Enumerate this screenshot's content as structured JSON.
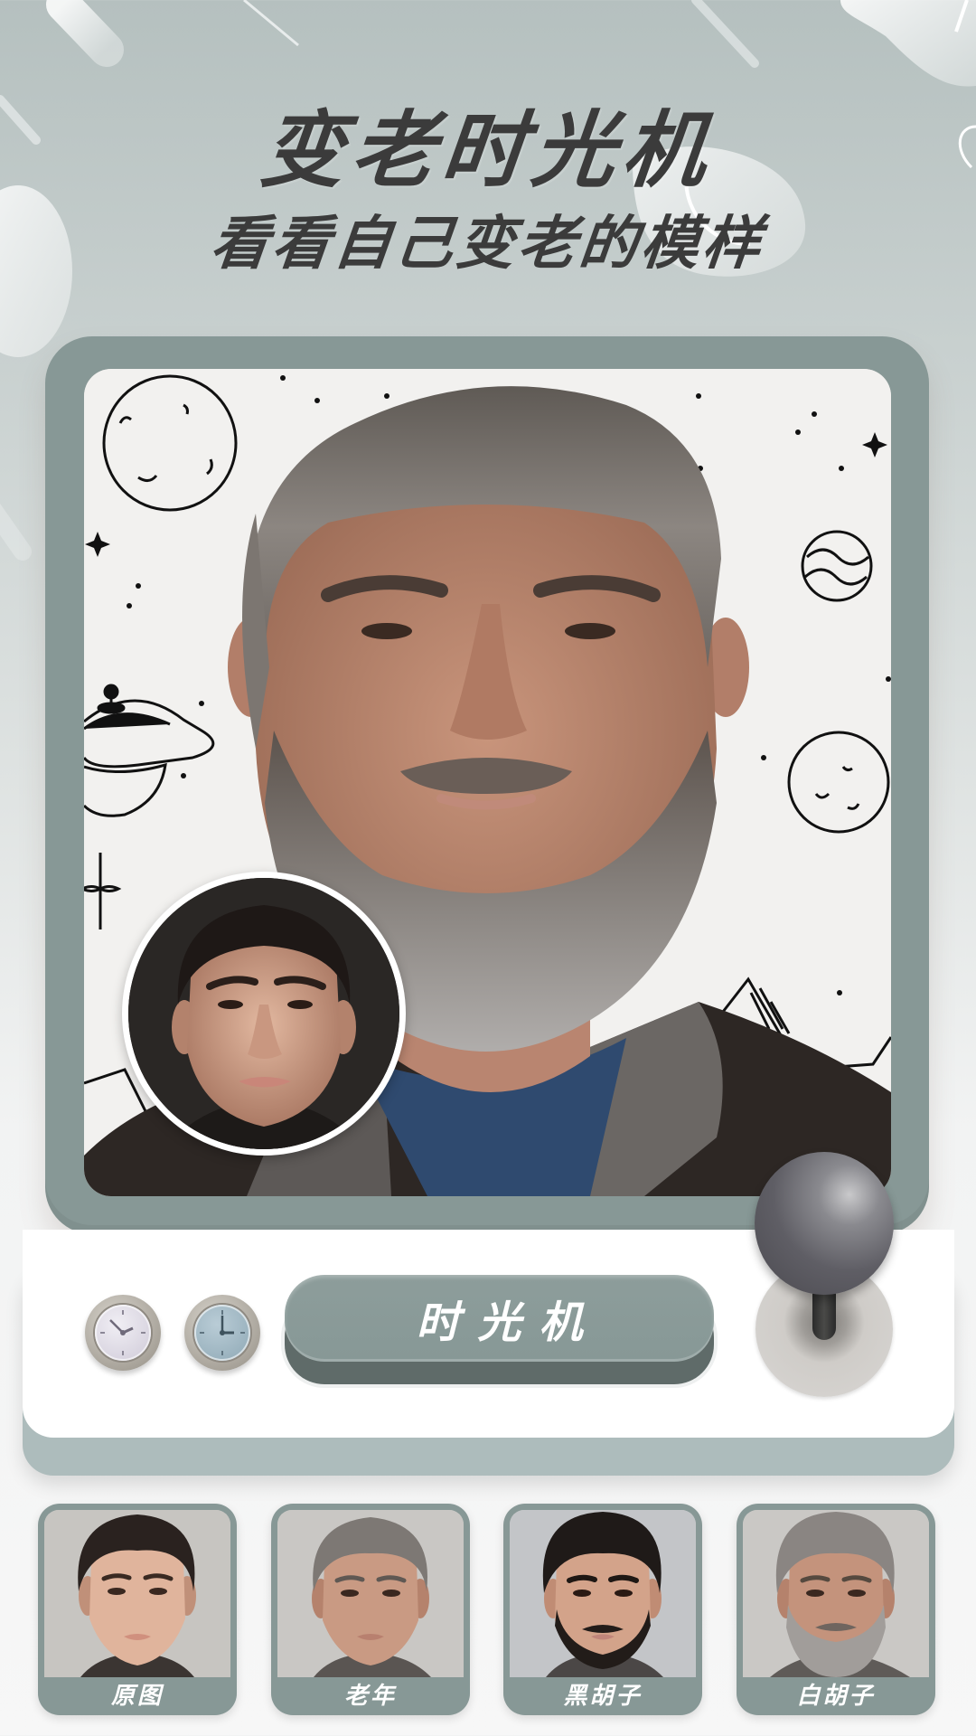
{
  "header": {
    "title": "变老时光机",
    "subtitle": "看看自己变老的模样"
  },
  "preview": {
    "main_image": "aged-man-with-gray-beard",
    "original_inset": "young-man-original",
    "background": "space-doodle-paper"
  },
  "controls": {
    "clock_left": {
      "icon": "clock-icon",
      "face_color": "#d9d5e0",
      "time": "10:08"
    },
    "clock_right": {
      "icon": "clock-icon",
      "face_color": "#9fb5c0",
      "time": "3:00"
    },
    "main_button_label": "时光机",
    "joystick": {
      "icon": "joystick-icon"
    }
  },
  "thumbnails": [
    {
      "label": "原图",
      "image": "young-man-original"
    },
    {
      "label": "老年",
      "image": "old-man"
    },
    {
      "label": "黑胡子",
      "image": "young-man-black-beard"
    },
    {
      "label": "白胡子",
      "image": "old-man-white-beard"
    }
  ],
  "colors": {
    "accent": "#879896",
    "accent_dark": "#5f6b69",
    "title_text": "#3b3b3b",
    "console_base": "#adbcbc"
  }
}
